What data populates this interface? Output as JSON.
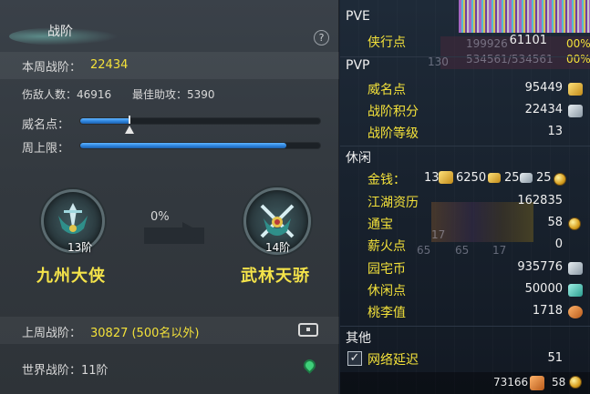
{
  "left": {
    "title": "战阶",
    "help": "?",
    "weekly": {
      "label": "本周战阶：",
      "value": "22434"
    },
    "damage_count": "伤敌人数：46916",
    "best_assist": "最佳助攻：5390",
    "prestige_label": "威名点：",
    "prestige_progress": 0.21,
    "weekly_cap_label": "周上限：",
    "weekly_cap_progress": 0.86,
    "progress_pct": "0%",
    "current_rank": {
      "level": "13阶",
      "name": "九州大侠"
    },
    "next_rank": {
      "level": "14阶",
      "name": "武林天骄"
    },
    "last_week": {
      "label": "上周战阶：",
      "value": "30827 (500名以外)"
    },
    "world_rank": "世界战阶：11阶"
  },
  "right": {
    "pve_head": "PVE",
    "pve_rows": [
      {
        "label": "侠行点",
        "value": "61101"
      }
    ],
    "pve_overlay": {
      "a": "199926",
      "b": "534561/534561",
      "c": "130",
      "pct1": "00%",
      "pct2": "00%"
    },
    "pvp_head": "PVP",
    "pvp_rows": [
      {
        "label": "威名点",
        "value": "95449",
        "icon": "prestige-icon"
      },
      {
        "label": "战阶积分",
        "value": "22434",
        "icon": "rank-score-icon"
      },
      {
        "label": "战阶等级",
        "value": "13",
        "icon": ""
      }
    ],
    "leisure_head": "休闲",
    "money": {
      "label": "金钱：",
      "gold": "13",
      "silver": "6250",
      "copper1": "25",
      "copper2": "25"
    },
    "leisure_rows": [
      {
        "label": "江湖资历",
        "value": "162835",
        "icon": ""
      },
      {
        "label": "通宝",
        "value": "58",
        "icon": "tongbao-icon"
      },
      {
        "label": "薪火点",
        "value": "0",
        "icon": ""
      },
      {
        "label": "园宅币",
        "value": "935776",
        "icon": "home-coin-icon"
      },
      {
        "label": "休闲点",
        "value": "50000",
        "icon": "leisure-point-icon"
      },
      {
        "label": "桃李值",
        "value": "1718",
        "icon": "peach-icon"
      }
    ],
    "skill_ghosts": [
      "17",
      "65",
      "65",
      "17"
    ],
    "other_head": "其他",
    "latency": {
      "label": "网络延迟",
      "value": "51",
      "checked": "✓"
    },
    "footer": {
      "a": "73166",
      "b": "58"
    }
  }
}
